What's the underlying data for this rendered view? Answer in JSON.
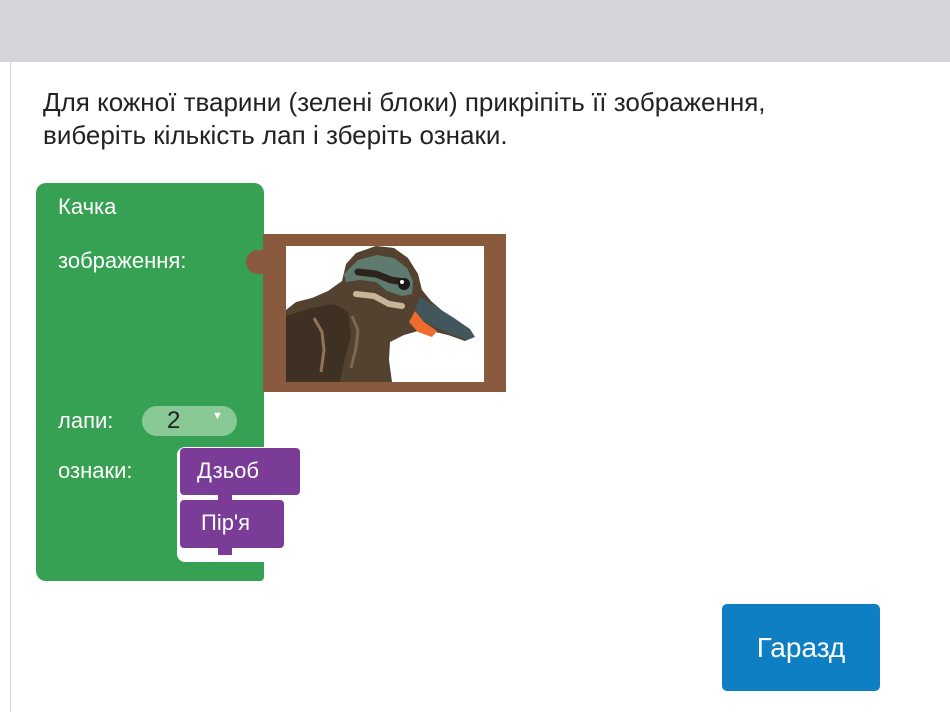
{
  "instruction": {
    "line1": "Для кожної тварини (зелені блоки) прикріпіть її зображення,",
    "line2": "виберіть кількість лап і зберіть ознаки."
  },
  "animal_block": {
    "name": "Качка",
    "image_label": "зображення:",
    "image_icon": "duck-photo",
    "legs_label": "лапи:",
    "legs_value": "2",
    "traits_label": "ознаки:",
    "traits": [
      "Дзьоб",
      "Пір'я"
    ]
  },
  "ok_button": {
    "label": "Гаразд"
  },
  "colors": {
    "animal_block": "#36a152",
    "trait_block": "#7a3c97",
    "image_frame": "#8a5a3f",
    "button": "#0e7fc3"
  }
}
